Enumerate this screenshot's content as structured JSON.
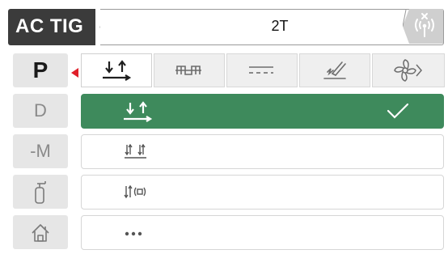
{
  "header": {
    "mode_title": "AC TIG",
    "program": "2T"
  },
  "icons": {
    "wireless": "wireless-antenna-icon",
    "home": "home-icon",
    "torch": "torch-icon",
    "check": "check-icon"
  },
  "sidebar": {
    "items": [
      {
        "label": "P",
        "active": true
      },
      {
        "label": "D",
        "active": false
      },
      {
        "label": "-M",
        "active": false
      },
      {
        "label": "",
        "icon": "gas-cylinder-icon",
        "active": false
      },
      {
        "label": "",
        "icon": "home-icon",
        "active": false
      }
    ]
  },
  "tabs": [
    {
      "icon": "two-stroke-icon",
      "active": true
    },
    {
      "icon": "pulse-wave-icon",
      "active": false
    },
    {
      "icon": "dc-current-icon",
      "active": false
    },
    {
      "icon": "welding-torch-icon",
      "active": false
    },
    {
      "icon": "fan-icon",
      "active": false
    }
  ],
  "list": {
    "selected_index": 0,
    "items": [
      {
        "icon": "two-stroke-icon"
      },
      {
        "icon": "four-stroke-icon"
      },
      {
        "icon": "spot-weld-icon"
      },
      {
        "icon": "more-icon"
      }
    ]
  },
  "colors": {
    "accent_green": "#3e8a5c",
    "header_dark": "#3b3b3b",
    "pointer_red": "#e0202a"
  }
}
